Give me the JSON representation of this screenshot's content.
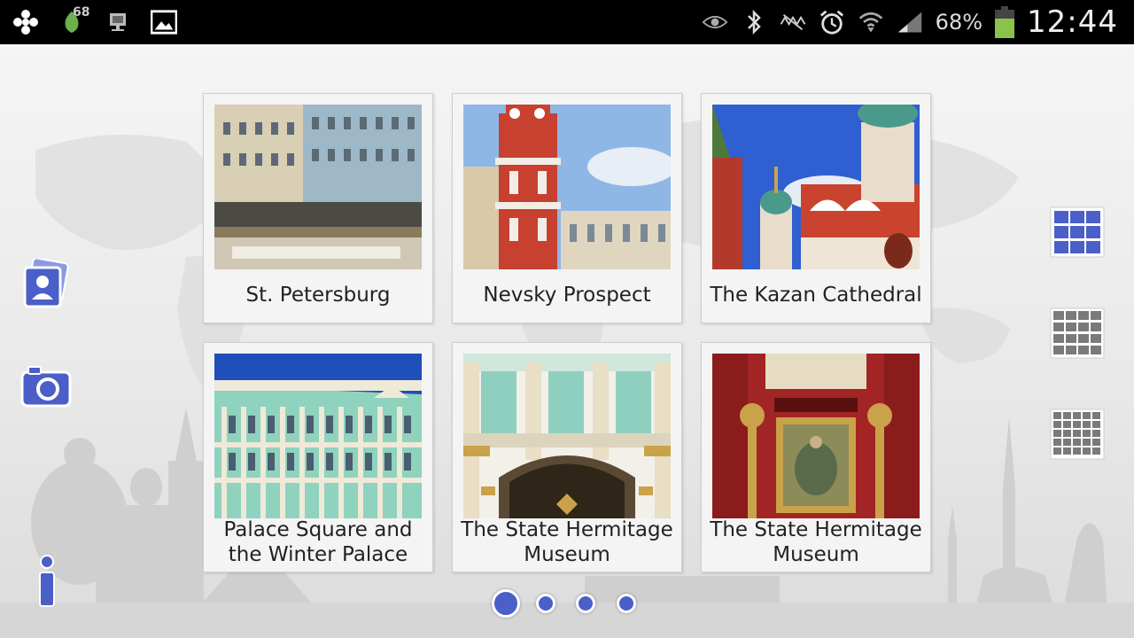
{
  "status_bar": {
    "notification_count": "68",
    "battery_percent": "68%",
    "battery_level": 0.68,
    "time": "12:44",
    "icons_left": [
      "app-icon",
      "leaf-icon",
      "device-icon",
      "image-icon"
    ],
    "icons_right": [
      "eye-icon",
      "bluetooth-icon",
      "mute-icon",
      "alarm-icon",
      "wifi-icon",
      "signal-icon",
      "battery-icon"
    ]
  },
  "gallery": {
    "cards": [
      {
        "label": "St. Petersburg"
      },
      {
        "label": "Nevsky Prospect"
      },
      {
        "label": "The Kazan Cathedral"
      },
      {
        "label": "Palace Square and the Winter Palace"
      },
      {
        "label": "The State Hermitage Museum"
      },
      {
        "label": "The State Hermitage Museum"
      }
    ]
  },
  "left_toolbar": [
    "contacts-photo-icon",
    "camera-icon",
    "info-icon"
  ],
  "right_toolbar": [
    "grid-3x3-icon",
    "grid-4x4-icon",
    "grid-5x5-icon"
  ],
  "pager": {
    "pages": 4,
    "current": 1
  },
  "colors": {
    "accent": "#4a5fc7",
    "status_bar": "#000000",
    "battery_fill": "#8bc34a"
  }
}
